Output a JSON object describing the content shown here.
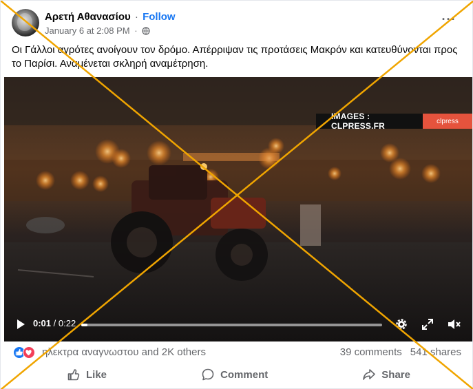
{
  "post": {
    "author_name": "Αρετή Αθανασίου",
    "separator": "·",
    "follow_label": "Follow",
    "timestamp": "January 6 at 2:08 PM",
    "meta_separator": "·",
    "privacy_icon": "globe-icon",
    "more_icon": "more-options-icon",
    "caption": "Οι Γάλλοι αγρότες ανοίγουν τον δρόμο. Απέρριψαν τις προτάσεις Μακρόν και κατευθύνονται προς το Παρίσι. Αναμένεται σκληρή αναμέτρηση."
  },
  "video": {
    "watermark_text": "IMAGES : CLPRESS.FR",
    "watermark_logo": "clpress",
    "current_time": "0:01",
    "time_separator": " / ",
    "total_time": "0:22",
    "progress_fraction": 0.02,
    "icons": [
      "play-icon",
      "settings-gear-icon",
      "fullscreen-icon",
      "mute-icon"
    ]
  },
  "engagement": {
    "reaction_icons": [
      "like-reaction-icon",
      "love-reaction-icon"
    ],
    "reactors_text": "ηλεκτρα αναγνωστου and 2K others",
    "comments_count": "39 comments",
    "shares_count": "541 shares"
  },
  "actions": {
    "like_label": "Like",
    "comment_label": "Comment",
    "share_label": "Share"
  },
  "colors": {
    "brand_blue": "#1877f2",
    "secondary_text": "#65676b",
    "fact_check_cross": "#f0a500",
    "love_red": "#f33e58"
  }
}
